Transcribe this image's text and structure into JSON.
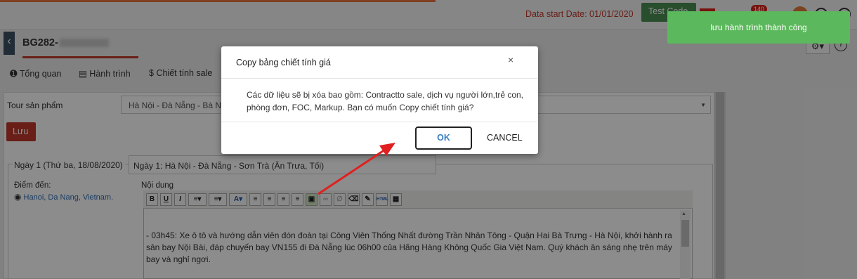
{
  "header": {
    "data_start": "Data start Date: 01/01/2020",
    "test_button": "Test Code",
    "notification_count": "140"
  },
  "record": {
    "code": "BG282-"
  },
  "tabs": [
    {
      "label": "Tổng quan",
      "icon": "info-icon"
    },
    {
      "label": "Hành trình",
      "icon": "map-icon"
    },
    {
      "label": "Chiết tính sale",
      "icon": "dollar-icon"
    }
  ],
  "form": {
    "tour_label": "Tour sản phẩm",
    "tour_value": "Hà Nội - Đà Nẵng - Bà Nà",
    "save_label": "Lưu",
    "day_legend": "Ngày 1 (Thứ ba, 18/08/2020)",
    "day_title": "Ngày 1: Hà Nội - Đà Nẵng - Sơn Trà (Ăn Trưa, Tối)",
    "destination_label": "Điểm đến:",
    "destination_value": "Hanoi, Da Nang, Vietnam.",
    "content_label": "Nội dung",
    "content_text": "- 03h45: Xe ô tô và hướng dẫn viên đón đoàn tại Công Viên Thống Nhất đường Trần Nhân Tông - Quận Hai Bà Trưng - Hà Nội, khởi hành ra sân bay Nội Bài, đáp chuyến bay VN155 đi Đà Nẵng lúc 06h00 của Hãng Hàng Không Quốc Gia Việt Nam. Quý khách ăn sáng nhẹ trên máy bay và nghỉ ngơi."
  },
  "modal": {
    "title": "Copy bảng chiết tính giá",
    "close": "×",
    "body": "Các dữ liệu sẽ bị xóa bao gồm: Contractto sale, dịch vụ người lớn,trẻ con, phòng đơn, FOC, Markup. Bạn có muốn Copy chiết tính giá?",
    "ok": "OK",
    "cancel": "CANCEL"
  },
  "toast": {
    "message": "lưu hành trình thành công"
  },
  "colors": {
    "brand_red": "#c0392b",
    "toast_green": "#5cb85c",
    "ok_blue": "#3a7fc1",
    "annotation_arrow": "#e02020"
  }
}
